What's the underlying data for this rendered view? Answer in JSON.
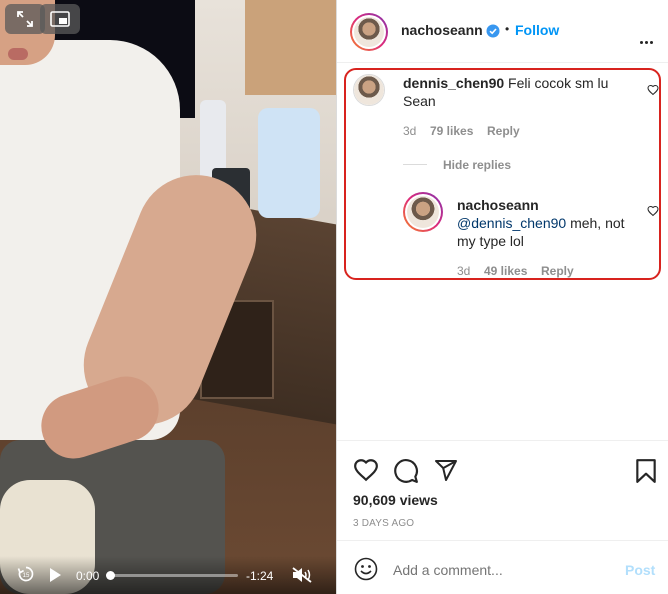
{
  "video": {
    "current_time": "0:00",
    "remaining_time": "-1:24",
    "progress": 0
  },
  "header": {
    "username": "nachoseann",
    "separator": "•",
    "follow_label": "Follow"
  },
  "comment": {
    "username": "dennis_chen90",
    "text": "Feli cocok sm lu Sean",
    "age": "3d",
    "likes": "79 likes",
    "reply_label": "Reply",
    "hide_replies_label": "Hide replies"
  },
  "reply": {
    "username": "nachoseann",
    "mention": "@dennis_chen90",
    "text": " meh, not my type lol",
    "age": "3d",
    "likes": "49 likes",
    "reply_label": "Reply"
  },
  "post": {
    "views": "90,609 views",
    "posted": "3 DAYS AGO"
  },
  "composer": {
    "placeholder": "Add a comment...",
    "post_label": "Post"
  },
  "colors": {
    "accent": "#0095f6",
    "highlight": "#d8231e",
    "verified": "#3897f0"
  }
}
